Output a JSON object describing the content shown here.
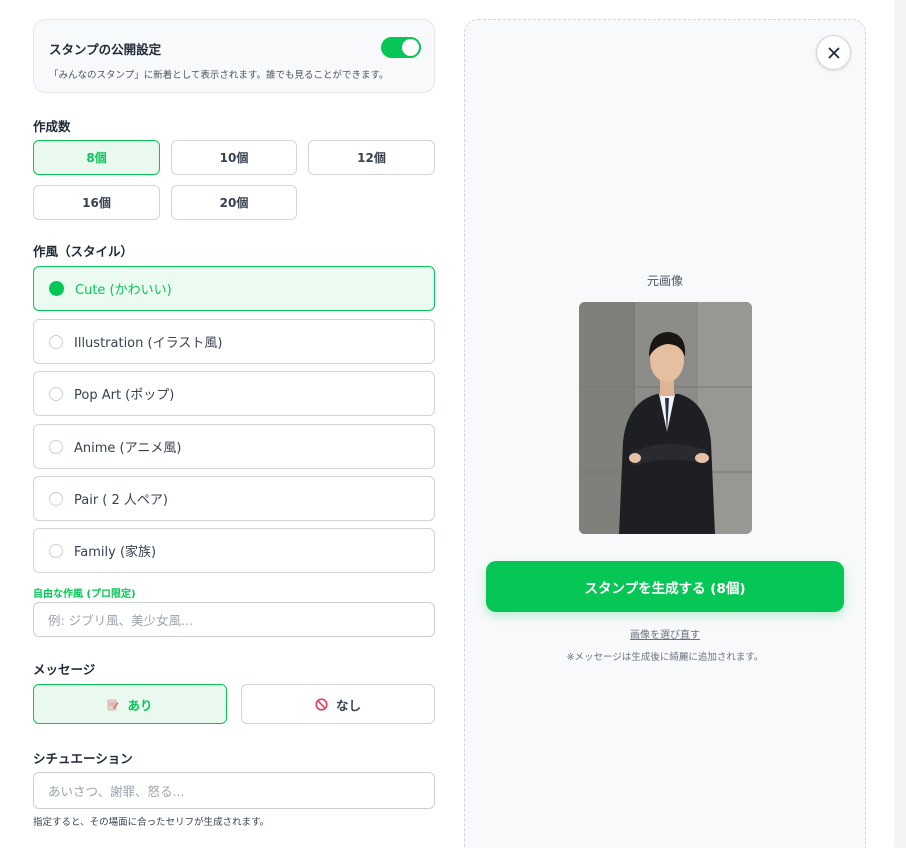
{
  "publish": {
    "title": "スタンプの公開設定",
    "description": "「みんなのスタンプ」に新着として表示されます。誰でも見ることができます。",
    "enabled": true
  },
  "count": {
    "label": "作成数",
    "options": [
      "8個",
      "10個",
      "12個",
      "16個",
      "20個"
    ],
    "selected": "8個"
  },
  "style": {
    "label": "作風（スタイル）",
    "options": [
      "Cute (かわいい)",
      "Illustration (イラスト風)",
      "Pop Art (ポップ)",
      "Anime (アニメ風)",
      "Pair ( 2 人ペア)",
      "Family (家族)"
    ],
    "selected": "Cute (かわいい)"
  },
  "free_style": {
    "label": "自由な作風 (プロ限定)",
    "placeholder": "例: ジブリ風、美少女風..."
  },
  "message": {
    "label": "メッセージ",
    "yes_label": "あり",
    "no_label": "なし",
    "selected": "あり"
  },
  "situation": {
    "label": "シチュエーション",
    "placeholder": "あいさつ、謝罪、怒る...",
    "hint": "指定すると、その場面に合ったセリフが生成されます。"
  },
  "preview": {
    "original_label": "元画像",
    "generate_button": "スタンプを生成する (8個)",
    "reselect_link": "画像を選び直す",
    "note": "※メッセージは生成後に綺麗に追加されます。"
  },
  "colors": {
    "accent": "#06c755",
    "accent_light": "#e9f9ef",
    "border": "#d1d5db"
  }
}
